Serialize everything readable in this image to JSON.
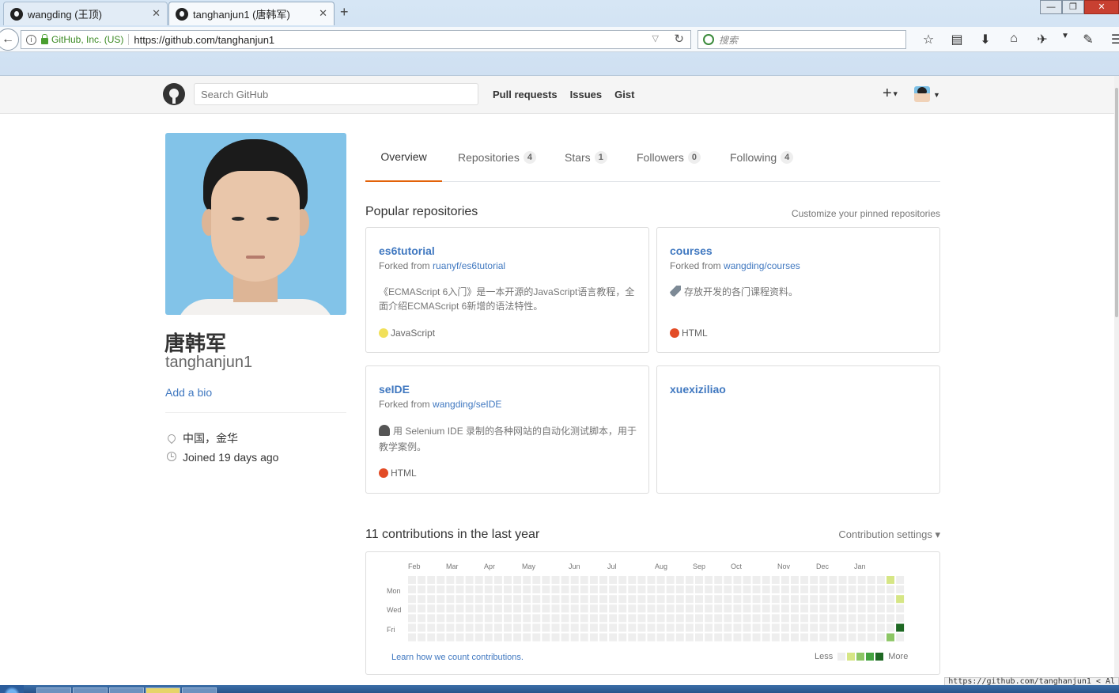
{
  "browser": {
    "tabs": [
      {
        "title": "wangding (王顶)",
        "active": false
      },
      {
        "title": "tanghanjun1 (唐韩军)",
        "active": true
      }
    ],
    "new_tab": "+",
    "identity": "GitHub, Inc. (US)",
    "url": "https://github.com/tanghanjun1",
    "search_placeholder": "搜索",
    "toolbar_icons": [
      "star-icon",
      "reading-list-icon",
      "download-icon",
      "home-icon",
      "extension-icon",
      "menu-caret-icon",
      "screenshot-icon",
      "hamburger-menu-icon"
    ],
    "status_url": "https://github.com/tanghanjun1 < Al"
  },
  "github_header": {
    "search_placeholder": "Search GitHub",
    "nav": [
      "Pull requests",
      "Issues",
      "Gist"
    ],
    "plus": "+"
  },
  "profile": {
    "fullname": "唐韩军",
    "username": "tanghanjun1",
    "add_bio": "Add a bio",
    "location": "中国，金华",
    "joined": "Joined 19 days ago"
  },
  "tabs": [
    {
      "label": "Overview",
      "count": null,
      "selected": true
    },
    {
      "label": "Repositories",
      "count": "4",
      "selected": false
    },
    {
      "label": "Stars",
      "count": "1",
      "selected": false
    },
    {
      "label": "Followers",
      "count": "0",
      "selected": false
    },
    {
      "label": "Following",
      "count": "4",
      "selected": false
    }
  ],
  "popular": {
    "title": "Popular repositories",
    "customize_link": "Customize your pinned repositories",
    "repos": [
      {
        "name": "es6tutorial",
        "fork_prefix": "Forked from",
        "fork_src": "ruanyf/es6tutorial",
        "desc": "《ECMAScript 6入门》是一本开源的JavaScript语言教程，全面介绍ECMAScript 6新增的语法特性。",
        "lang": "JavaScript",
        "lang_color": "#f1e05a"
      },
      {
        "name": "courses",
        "fork_prefix": "Forked from",
        "fork_src": "wangding/courses",
        "desc": "存放开发的各门课程资料。",
        "desc_icon": "rocket-icon",
        "lang": "HTML",
        "lang_color": "#e34c26"
      },
      {
        "name": "seIDE",
        "fork_prefix": "Forked from",
        "fork_src": "wangding/seIDE",
        "desc": "用 Selenium IDE 录制的各种网站的自动化测试脚本，用于教学案例。",
        "desc_icon": "bell-icon",
        "lang": "HTML",
        "lang_color": "#e34c26"
      },
      {
        "name": "xuexiziliao"
      }
    ]
  },
  "contributions": {
    "title": "11 contributions in the last year",
    "settings": "Contribution settings ▾",
    "months": [
      "Feb",
      "Mar",
      "Apr",
      "May",
      "Jun",
      "Jul",
      "Aug",
      "Sep",
      "Oct",
      "Nov",
      "Dec",
      "Jan"
    ],
    "weekdays": [
      "Mon",
      "Wed",
      "Fri"
    ],
    "learn_link": "Learn how we count contributions.",
    "legend_less": "Less",
    "legend_more": "More",
    "colors": [
      "#eeeeee",
      "#d6e685",
      "#8cc665",
      "#44a340",
      "#1e6823"
    ],
    "active_days": [
      {
        "week": 50,
        "day": 0,
        "level": 1
      },
      {
        "week": 51,
        "day": 2,
        "level": 1
      },
      {
        "week": 51,
        "day": 5,
        "level": 4
      },
      {
        "week": 50,
        "day": 6,
        "level": 2
      }
    ]
  }
}
